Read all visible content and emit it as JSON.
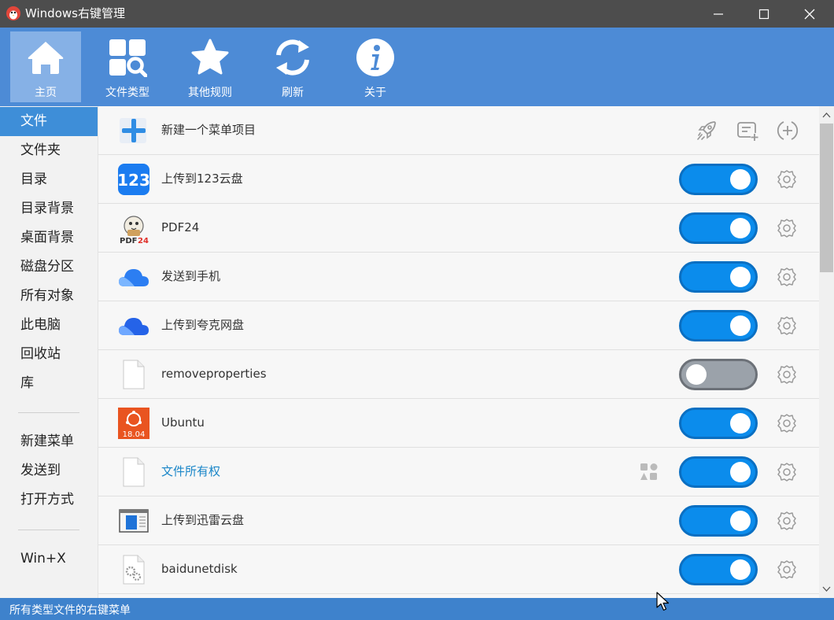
{
  "window": {
    "title": "Windows右键管理"
  },
  "toolbar": {
    "home": "主页",
    "file_types": "文件类型",
    "other_rules": "其他规则",
    "refresh": "刷新",
    "about": "关于"
  },
  "sidebar": {
    "group1": [
      "文件",
      "文件夹",
      "目录",
      "目录背景",
      "桌面背景",
      "磁盘分区",
      "所有对象",
      "此电脑",
      "回收站",
      "库"
    ],
    "group2": [
      "新建菜单",
      "发送到",
      "打开方式"
    ],
    "group3": [
      "Win+X"
    ]
  },
  "new_item": {
    "label": "新建一个菜单项目"
  },
  "items": [
    {
      "label": "上传到123云盘",
      "enabled": true,
      "icon": "cloud-123-icon"
    },
    {
      "label": "PDF24",
      "enabled": true,
      "icon": "pdf24-icon"
    },
    {
      "label": "发送到手机",
      "enabled": true,
      "icon": "cloud-icon"
    },
    {
      "label": "上传到夸克网盘",
      "enabled": true,
      "icon": "cloud-icon"
    },
    {
      "label": "removeproperties",
      "enabled": false,
      "icon": "blank-file-icon"
    },
    {
      "label": "Ubuntu",
      "enabled": true,
      "icon": "ubuntu-icon",
      "badge": "18.04"
    },
    {
      "label": "文件所有权",
      "enabled": true,
      "icon": "blank-file-icon"
    },
    {
      "label": "上传到迅雷云盘",
      "enabled": true,
      "icon": "window-app-icon"
    },
    {
      "label": "baidunetdisk",
      "enabled": true,
      "icon": "gear-file-icon"
    }
  ],
  "status": {
    "text": "所有类型文件的右键菜单"
  },
  "colors": {
    "accent": "#4d8bd6",
    "toggle_on": "#0b8cec",
    "toggle_off": "#9ba2aa",
    "status_bar": "#3e82cc"
  }
}
